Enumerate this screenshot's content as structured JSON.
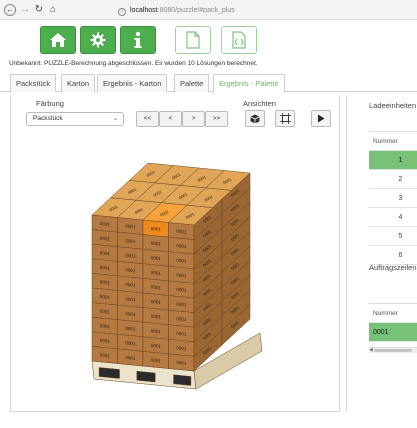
{
  "browser": {
    "url_host": "localhost",
    "url_rest": ":8080/puzzle/#pack_plus"
  },
  "status": {
    "text": "Unbekannt:  PUZZLE-Berechnung abgeschlossen. Es wurden 10 Lösungen berechnet."
  },
  "tabs": [
    {
      "label": "Packstück"
    },
    {
      "label": "Karton"
    },
    {
      "label": "Ergebnis - Karton"
    },
    {
      "label": "Palette"
    },
    {
      "label": "Ergebnis - Palette"
    }
  ],
  "controls": {
    "faerbung_label": "Färbung",
    "faerbung_value": "Packstück",
    "ansichten_label": "Ansichten",
    "pager": [
      "<<",
      "<",
      ">",
      ">>"
    ]
  },
  "boxes": {
    "label": "0001"
  },
  "right_panel": {
    "ladeeinheiten_title": "Ladeeinheiten",
    "ladeeinheiten_header": "Nummer",
    "ladeeinheiten_rows": [
      "1",
      "2",
      "3",
      "4",
      "5",
      "6"
    ],
    "auftragszeilen_title": "Auftragszeilen",
    "auftragszeilen_header": "Nummer",
    "auftragszeilen_rows": [
      "0001"
    ]
  },
  "colors": {
    "accent_green": "#4cae4c",
    "selected_row": "#78c277",
    "box_front": "#b47a42",
    "box_side": "#9a6634",
    "box_top": "#e0a657",
    "highlight_box": "#ee8a1e"
  }
}
